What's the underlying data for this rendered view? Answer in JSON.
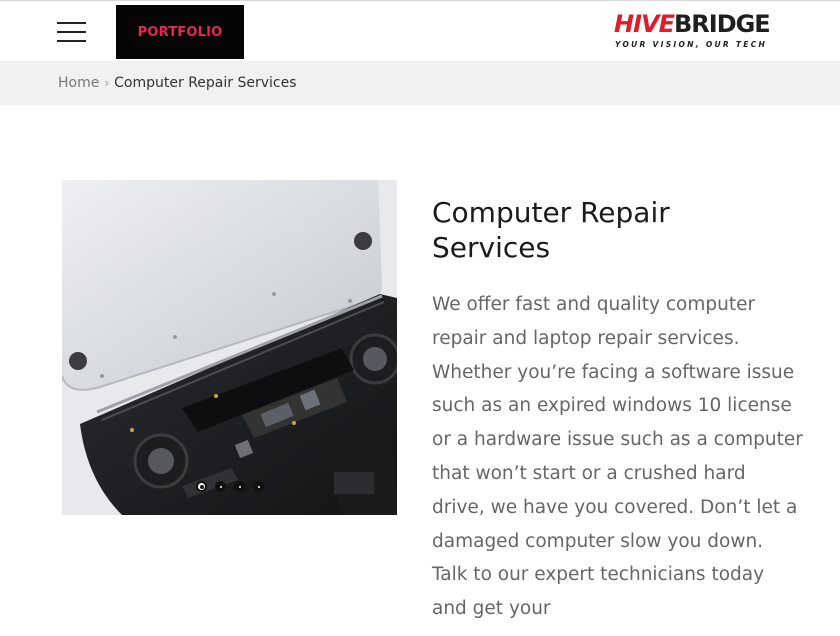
{
  "header": {
    "portfolio_label": "PORTFOLIO",
    "logo": {
      "hive": "HIVE",
      "bridge": "BRIDGE",
      "tagline": "YOUR VISION, OUR TECH"
    }
  },
  "breadcrumb": {
    "home": "Home",
    "separator": "›",
    "current": "Computer Repair Services"
  },
  "slider": {
    "slide_count": 4,
    "active_slide": 1
  },
  "content": {
    "title": "Computer Repair Services",
    "description": "We offer fast and quality computer repair and laptop repair services. Whether you’re facing a software issue such as an expired windows 10 license or a hardware issue such as a computer that won’t start or a crushed hard drive, we have you covered. Don’t let a damaged computer slow you down. Talk to our expert technicians today and get your"
  },
  "colors": {
    "brand_red": "#e11c2a",
    "portfolio_pink": "#e8265a",
    "breadcrumb_bg": "#f1f1f1"
  },
  "icons": {
    "menu": "hamburger-menu-icon",
    "breadcrumb_separator": "chevron-right-icon"
  }
}
